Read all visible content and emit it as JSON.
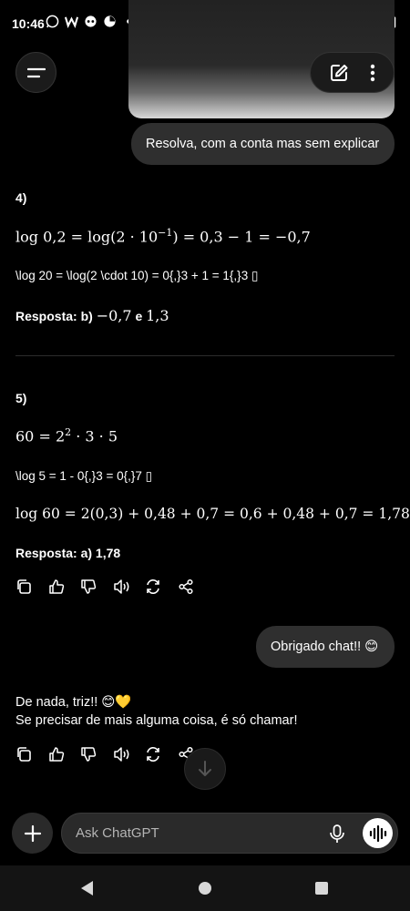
{
  "status_bar": {
    "time": "10:46",
    "left_icons": [
      "whatsapp-icon",
      "w-app-icon",
      "game-icon",
      "pie-app-icon",
      "dot-icon"
    ],
    "right_icons": [
      "alarm-icon",
      "wifi-icon",
      "signal-icon",
      "battery-icon"
    ]
  },
  "header": {
    "menu_icon": "hamburger-icon",
    "new_chat_icon": "edit-icon",
    "more_icon": "more-vertical-icon"
  },
  "messages": {
    "user_prompt": "Resolva, com a conta mas sem explicar",
    "q4": {
      "number": "4)",
      "line1": "log 0,2 = log(2 · 10",
      "line1_exp": "−1",
      "line1_end": ") = 0,3 − 1 = −0,7",
      "line2_raw": "\\log 20 = \\log(2 \\cdot 10) = 0{,}3 + 1 = 1{,}3 ▯",
      "answer_label": "Resposta: b)",
      "answer_val1": "−0,7",
      "answer_and": "e",
      "answer_val2": "1,3"
    },
    "q5": {
      "number": "5)",
      "line1_a": "60 = 2",
      "line1_exp": "2",
      "line1_b": " · 3 · 5",
      "line2_raw": "\\log 5 = 1 - 0{,}3 = 0{,}7 ▯",
      "line3": "log 60 = 2(0,3) + 0,48 + 0,7 = 0,6 + 0,48 + 0,7 = 1,78",
      "answer": "Resposta: a) 1,78"
    },
    "user_thanks": "Obrigado chat!! 😊",
    "reply_line1": "De nada, triz!! 😊💛",
    "reply_line2": "Se precisar de mais alguma coisa, é só chamar!"
  },
  "action_icons": [
    "copy-icon",
    "thumbs-up-icon",
    "thumbs-down-icon",
    "read-aloud-icon",
    "regenerate-icon",
    "share-icon"
  ],
  "composer": {
    "placeholder": "Ask ChatGPT",
    "plus_icon": "plus-icon",
    "mic_icon": "mic-icon",
    "voice_icon": "voice-mode-icon"
  },
  "nav": [
    "back-icon",
    "home-icon",
    "recents-icon"
  ]
}
